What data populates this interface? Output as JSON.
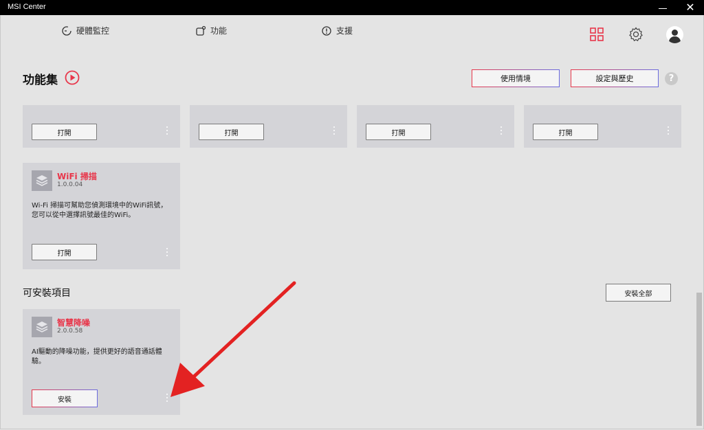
{
  "window": {
    "title": "MSI Center"
  },
  "nav": {
    "items": [
      {
        "label": "硬體監控",
        "icon": "monitor-icon"
      },
      {
        "label": "功能",
        "icon": "features-icon"
      },
      {
        "label": "支援",
        "icon": "support-icon"
      }
    ],
    "right_icons": [
      "grid-icon",
      "gear-icon",
      "user-avatar-icon"
    ]
  },
  "section": {
    "title": "功能集",
    "buttons": {
      "scenario": "使用情境",
      "settings_history": "設定與歷史"
    },
    "help": "?"
  },
  "top_cards": [
    {
      "button": "打開"
    },
    {
      "button": "打開"
    },
    {
      "button": "打開"
    },
    {
      "button": "打開"
    }
  ],
  "wifi_card": {
    "name": "WiFi 掃描",
    "version": "1.0.0.04",
    "description_line1": "Wi-Fi 掃描可幫助您偵測環境中的WiFi訊號，",
    "description_line2": "您可以從中選擇訊號最佳的WiFi。",
    "button": "打開"
  },
  "installable": {
    "title": "可安裝項目",
    "install_all": "安裝全部",
    "card": {
      "name": "智慧降噪",
      "version": "2.0.0.58",
      "description_line1": "AI驅動的降噪功能，提供更好的語音通話體",
      "description_line2": "驗。",
      "button": "安裝"
    }
  },
  "colors": {
    "accent": "#e8364a",
    "accent2": "#6a6adf",
    "card_bg": "#d4d4d8",
    "page_bg": "#e4e4e4"
  }
}
